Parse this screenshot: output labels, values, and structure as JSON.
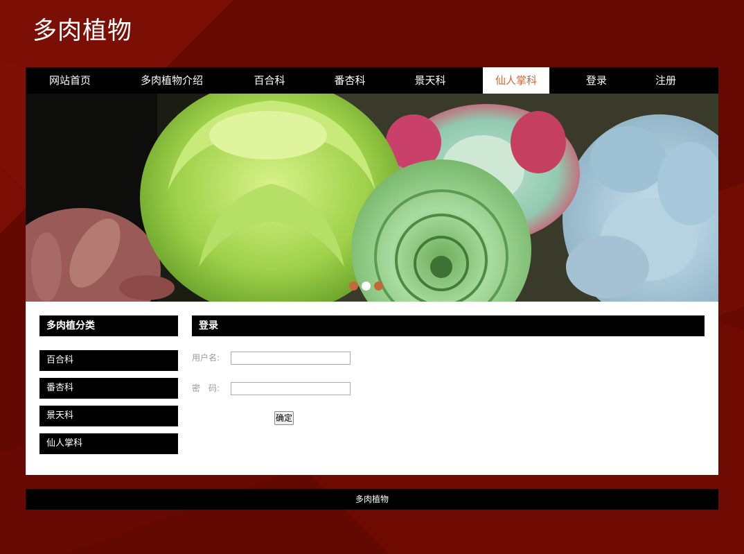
{
  "site": {
    "title": "多肉植物"
  },
  "nav": {
    "items": [
      {
        "label": "网站首页"
      },
      {
        "label": "多肉植物介绍"
      },
      {
        "label": "百合科"
      },
      {
        "label": "番杏科"
      },
      {
        "label": "景天科"
      },
      {
        "label": "仙人掌科"
      },
      {
        "label": "登录"
      },
      {
        "label": "注册"
      }
    ],
    "active_label": "仙人掌科"
  },
  "banner": {
    "slide_count": 3,
    "active_slide": 2,
    "dot_color": "#c4673a",
    "active_dot_color": "#ffffff"
  },
  "sidebar": {
    "heading": "多肉植分类",
    "items": [
      {
        "label": "百合科"
      },
      {
        "label": "番杏科"
      },
      {
        "label": "景天科"
      },
      {
        "label": "仙人掌科"
      }
    ]
  },
  "login": {
    "heading": "登录",
    "username_label": "用户名:",
    "username_value": "",
    "password_label": "密　码:",
    "password_value": "",
    "submit_label": "确定"
  },
  "footer": {
    "text": "多肉植物"
  },
  "colors": {
    "accent": "#c4673a",
    "background": "#6e0a02"
  }
}
